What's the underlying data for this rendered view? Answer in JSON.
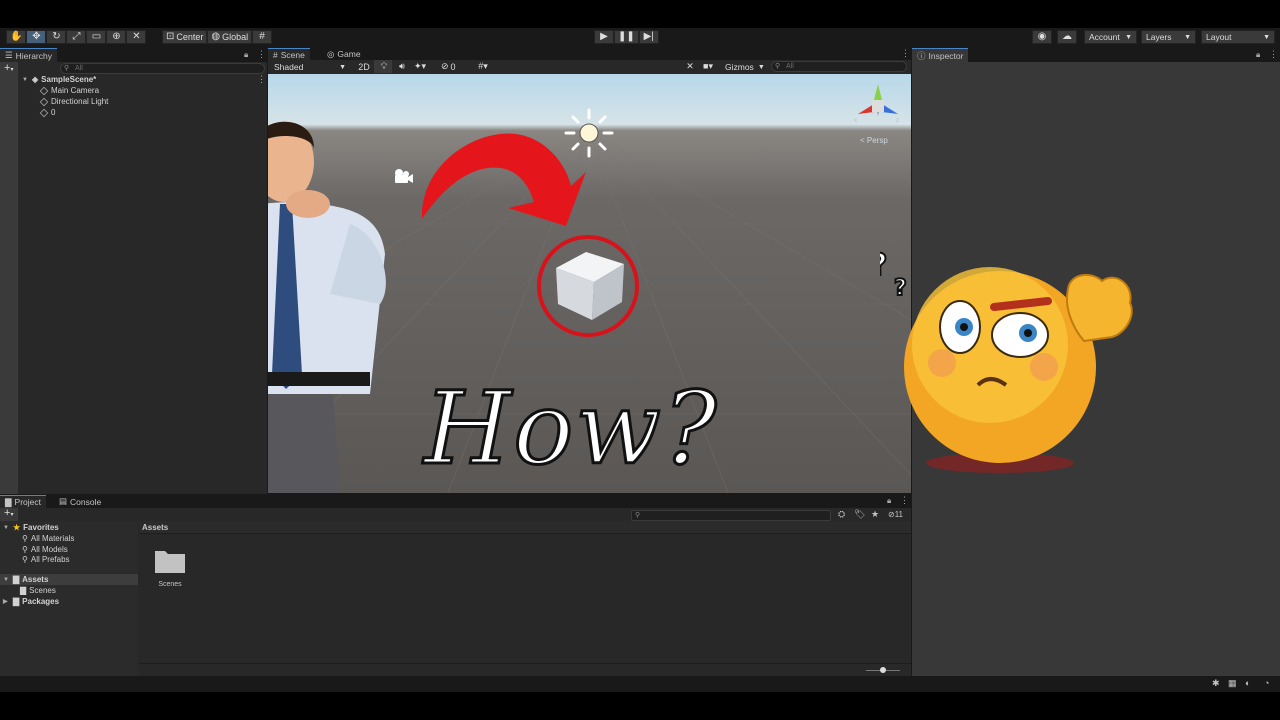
{
  "toolbar": {
    "tools": [
      {
        "icon": "hand-tool-icon"
      },
      {
        "icon": "move-tool-icon"
      },
      {
        "icon": "rotate-tool-icon"
      },
      {
        "icon": "scale-tool-icon"
      },
      {
        "icon": "rect-tool-icon"
      },
      {
        "icon": "transform-tool-icon"
      },
      {
        "icon": "custom-tool-icon"
      }
    ],
    "pivot_label": "Center",
    "space_label": "Global",
    "account_label": "Account",
    "layers_label": "Layers",
    "layout_label": "Layout"
  },
  "hierarchy": {
    "tab_label": "Hierarchy",
    "search_placeholder": "All",
    "scene_name": "SampleScene*",
    "items": [
      "Main Camera",
      "Directional Light",
      "0"
    ]
  },
  "scene": {
    "tab_scene": "Scene",
    "tab_game": "Game",
    "shading_mode": "Shaded",
    "mode_2d": "2D",
    "hidden_count": "0",
    "gizmos_label": "Gizmos",
    "search_placeholder": "All",
    "persp_label": "< Persp",
    "overlay_text": "How?"
  },
  "inspector": {
    "tab_label": "Inspector"
  },
  "project": {
    "tab_project": "Project",
    "tab_console": "Console",
    "favorites_label": "Favorites",
    "favorites": [
      "All Materials",
      "All Models",
      "All Prefabs"
    ],
    "assets_label": "Assets",
    "asset_folders": [
      "Scenes"
    ],
    "packages_label": "Packages",
    "breadcrumb": "Assets",
    "grid_items": [
      "Scenes"
    ],
    "hidden_count": "11"
  },
  "colors": {
    "accent": "#46607c",
    "arrow": "#e5161b",
    "circle": "#d8121b"
  }
}
